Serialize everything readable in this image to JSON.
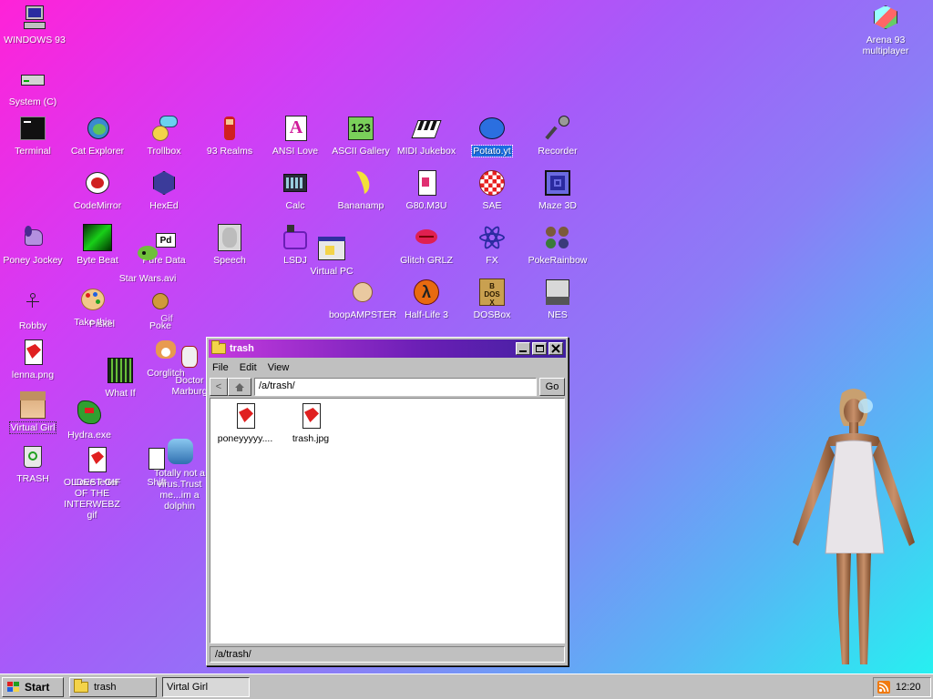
{
  "desktop": {
    "icons": [
      {
        "label": "WINDOWS 93",
        "icon": "computer-icon"
      },
      {
        "label": "System (C)",
        "icon": "drive-icon"
      },
      {
        "label": "Terminal",
        "icon": "terminal-icon"
      },
      {
        "label": "Cat Explorer",
        "icon": "cat-explorer-icon"
      },
      {
        "label": "Trollbox",
        "icon": "trollbox-icon"
      },
      {
        "label": "93 Realms",
        "icon": "realms-icon"
      },
      {
        "label": "ANSI Love",
        "icon": "ansi-icon"
      },
      {
        "label": "ASCII Gallery",
        "icon": "ascii-icon"
      },
      {
        "label": "MIDI Jukebox",
        "icon": "piano-icon"
      },
      {
        "label": "Potato.yt",
        "icon": "potato-icon"
      },
      {
        "label": "Recorder",
        "icon": "microphone-icon"
      },
      {
        "label": "CodeMirror",
        "icon": "codemirror-icon"
      },
      {
        "label": "HexEd",
        "icon": "hex-cube-icon"
      },
      {
        "label": "Calc",
        "icon": "calculator-icon"
      },
      {
        "label": "Bananamp",
        "icon": "banana-icon"
      },
      {
        "label": "G80.M3U",
        "icon": "audio-file-icon"
      },
      {
        "label": "SAE",
        "icon": "amiga-ball-icon"
      },
      {
        "label": "Maze 3D",
        "icon": "maze-icon"
      },
      {
        "label": "Poney Jockey",
        "icon": "pony-icon"
      },
      {
        "label": "Byte Beat",
        "icon": "bytebeat-icon"
      },
      {
        "label": "Pure Data",
        "icon": "puredata-icon"
      },
      {
        "label": "Speech",
        "icon": "speech-face-icon"
      },
      {
        "label": "LSDJ",
        "icon": "gameboy-icon"
      },
      {
        "label": "Virtual PC",
        "icon": "virtual-pc-icon"
      },
      {
        "label": "Glitch GRLZ",
        "icon": "lips-icon"
      },
      {
        "label": "FX",
        "icon": "atom-icon"
      },
      {
        "label": "PokeRainbow",
        "icon": "pokerainbow-icon"
      },
      {
        "label": "Star Wars.avi",
        "icon": "yoda-icon"
      },
      {
        "label": "Robby",
        "icon": "stickman-icon"
      },
      {
        "label": "Take this",
        "icon": "palette-icon"
      },
      {
        "label": "Piskel",
        "icon": "piskel-icon"
      },
      {
        "label": "Poke",
        "icon": "poke-icon"
      },
      {
        "label": "Gif",
        "icon": "gif-icon"
      },
      {
        "label": "boopAMPSTER",
        "icon": "hamster-icon"
      },
      {
        "label": "Half-Life 3",
        "icon": "half-life-icon"
      },
      {
        "label": "DOSBox",
        "icon": "dosbox-icon"
      },
      {
        "label": "NES",
        "icon": "nes-icon"
      },
      {
        "label": "lenna.png",
        "icon": "image-file-icon"
      },
      {
        "label": "What If",
        "icon": "what-if-icon"
      },
      {
        "label": "Corglitch",
        "icon": "corgi-icon"
      },
      {
        "label": "Doctor Marburg",
        "icon": "doctor-icon"
      },
      {
        "label": "Virtual Girl",
        "icon": "girl-face-icon"
      },
      {
        "label": "Hydra.exe",
        "icon": "hydra-icon"
      },
      {
        "label": "TRASH",
        "icon": "recycle-bin-icon"
      },
      {
        "label": "Love letter",
        "icon": "letter-icon"
      },
      {
        "label": "OLDEST GIF OF THE INTERWEBZ gif",
        "icon": "gif-file-icon"
      },
      {
        "label": "Shift",
        "icon": "shift-icon"
      },
      {
        "label": "Totally not a virus.Trust me...im a dolphin",
        "icon": "dolphin-icon"
      },
      {
        "label": "Arena 93 multiplayer",
        "icon": "arena-cube-icon"
      }
    ]
  },
  "window": {
    "title": "trash",
    "menu": [
      "File",
      "Edit",
      "View"
    ],
    "address": "/a/trash/",
    "go_label": "Go",
    "files": [
      {
        "label": "poneyyyyy....",
        "icon": "image-file-icon"
      },
      {
        "label": "trash.jpg",
        "icon": "image-file-icon"
      }
    ],
    "status": "/a/trash/"
  },
  "taskbar": {
    "start_label": "Start",
    "tasks": [
      {
        "label": "trash",
        "icon": "folder-icon"
      },
      {
        "label": "Virtal Girl"
      }
    ],
    "clock": "12:20",
    "tray_icon": "rss-icon"
  },
  "colors": {
    "selection": "#1a6de0",
    "titlebar_start": "#c63adf",
    "titlebar_end": "#4020a0",
    "chrome": "#c0c0c0"
  }
}
